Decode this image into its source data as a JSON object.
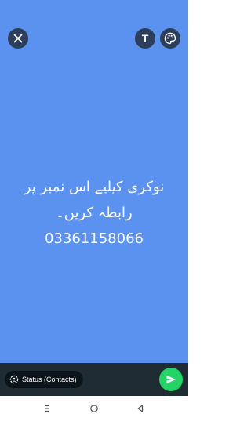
{
  "status_text": {
    "line1": "نوکری کیلیے اس نمبر پر",
    "line2": "رابطہ کریں۔",
    "line3": "03361158066"
  },
  "toolbar": {
    "close_icon": "close-icon",
    "text_icon": "text-tool-icon",
    "text_glyph": "T",
    "palette_icon": "palette-icon"
  },
  "bottom_bar": {
    "audience_label": "Status (Contacts)",
    "audience_icon": "status-privacy-icon",
    "send_icon": "send-icon"
  },
  "colors": {
    "background": "#5b92f0",
    "send_button": "#25d366",
    "bottom_bar": "#1f2c34"
  },
  "navbar": {
    "recents_icon": "recents-icon",
    "home_icon": "home-icon",
    "back_icon": "back-icon"
  }
}
